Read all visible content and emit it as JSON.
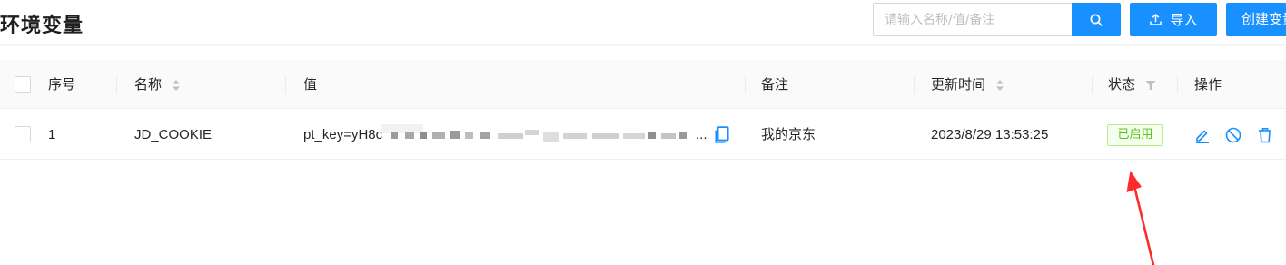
{
  "header": {
    "title": "环境变量",
    "search_placeholder": "请输入名称/值/备注",
    "search_icon": "search-icon",
    "import_label": "导入",
    "import_icon": "upload-icon",
    "create_label": "创建变量"
  },
  "table": {
    "columns": {
      "index": "序号",
      "name": "名称",
      "value": "值",
      "remarks": "备注",
      "updated": "更新时间",
      "status": "状态",
      "actions": "操作"
    },
    "rows": [
      {
        "index": "1",
        "name": "JD_COOKIE",
        "value_prefix": "pt_key=yH8c",
        "value_ellipsis": "...",
        "remarks": "我的京东",
        "updated": "2023/8/29 13:53:25",
        "status": "已启用"
      }
    ]
  },
  "colors": {
    "primary": "#1890ff",
    "status_green": "#52c41a",
    "arrow_red": "#ff2a2a"
  }
}
